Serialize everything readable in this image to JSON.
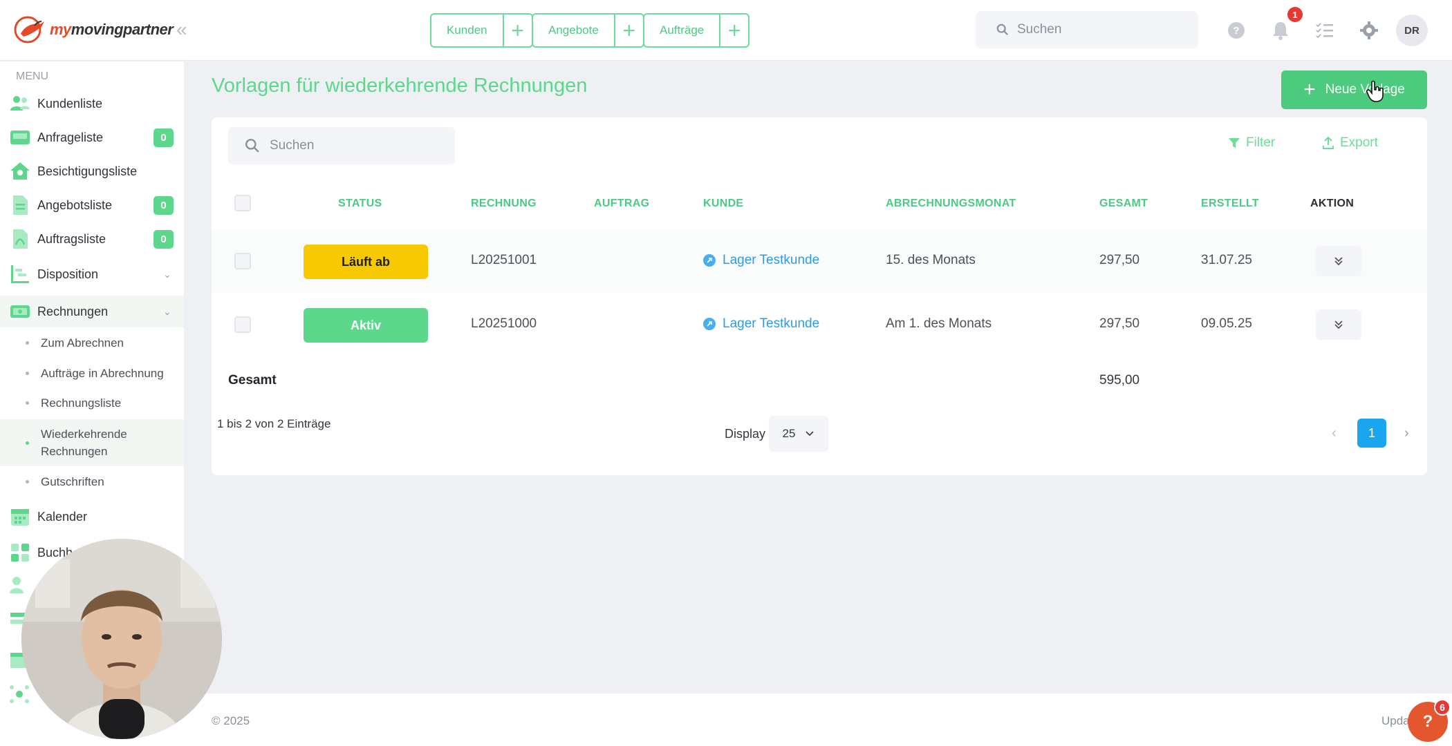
{
  "brand": {
    "logo_prefix": "my",
    "logo_rest": "movingpartner"
  },
  "quick_links": [
    {
      "label": "Kunden"
    },
    {
      "label": "Angebote"
    },
    {
      "label": "Aufträge"
    }
  ],
  "top_search": {
    "placeholder": "Suchen"
  },
  "notifications": {
    "count": "1"
  },
  "user": {
    "initials": "DR"
  },
  "sidebar": {
    "menu_title": "MENU",
    "items": [
      {
        "label": "Kundenliste"
      },
      {
        "label": "Anfrageliste",
        "badge": "0"
      },
      {
        "label": "Besichtigungsliste"
      },
      {
        "label": "Angebotsliste",
        "badge": "0"
      },
      {
        "label": "Auftragsliste",
        "badge": "0"
      },
      {
        "label": "Disposition"
      },
      {
        "label": "Rechnungen"
      },
      {
        "label": "Kalender"
      },
      {
        "label": "Buchh"
      }
    ],
    "sub_items": [
      {
        "label": "Zum Abrechnen"
      },
      {
        "label": "Aufträge in Abrechnung"
      },
      {
        "label": "Rechnungsliste"
      },
      {
        "label": "Wiederkehrende Rechnungen"
      },
      {
        "label": "Gutschriften"
      }
    ]
  },
  "page": {
    "title": "Vorlagen für wiederkehrende Rechnungen",
    "new_button": "Neue Vorlage"
  },
  "table": {
    "search_placeholder": "Suchen",
    "filter_label": "Filter",
    "export_label": "Export",
    "headers": {
      "status": "STATUS",
      "rechnung": "RECHNUNG",
      "auftrag": "AUFTRAG",
      "kunde": "KUNDE",
      "abrechnungsmonat": "ABRECHNUNGSMONAT",
      "gesamt": "GESAMT",
      "erstellt": "ERSTELLT",
      "aktion": "AKTION"
    },
    "rows": [
      {
        "status": "Läuft ab",
        "status_color": "#f7c900",
        "rechnung": "L20251001",
        "auftrag": "",
        "kunde": "Lager Testkunde",
        "abrechnungsmonat": "15. des Monats",
        "gesamt": "297,50",
        "erstellt": "31.07.25"
      },
      {
        "status": "Aktiv",
        "status_color": "#5cd78c",
        "rechnung": "L20251000",
        "auftrag": "",
        "kunde": "Lager Testkunde",
        "abrechnungsmonat": "Am 1. des Monats",
        "gesamt": "297,50",
        "erstellt": "09.05.25"
      }
    ],
    "total_label": "Gesamt",
    "total_value": "595,00",
    "entries_text": "1 bis 2 von 2 Einträge",
    "display_label": "Display",
    "page_size": "25",
    "current_page": "1"
  },
  "footer": {
    "copyright": "© 2025",
    "update_text": "Upda"
  },
  "help": {
    "icon": "?",
    "badge": "6"
  },
  "colors": {
    "accent_green": "#5cd78c",
    "link_blue": "#2c9be6",
    "page_blue": "#1aa6ec",
    "warning_yellow": "#f7c900",
    "brand_red": "#e24a2a"
  }
}
